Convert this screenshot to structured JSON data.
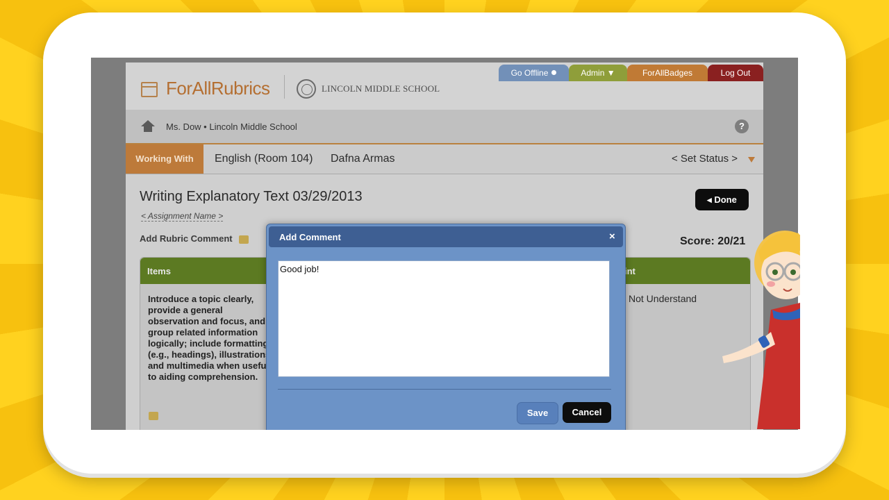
{
  "brand": {
    "app_name": "ForAllRubrics",
    "school_name": "LINCOLN MIDDLE SCHOOL"
  },
  "top_nav": [
    {
      "label": "Go Offline",
      "color": "#7290b8"
    },
    {
      "label": "Admin ▼",
      "color": "#8f9e3a"
    },
    {
      "label": "ForAllBadges",
      "color": "#c07a35"
    },
    {
      "label": "Log Out",
      "color": "#8a2020"
    }
  ],
  "breadcrumb": {
    "text": "Ms. Dow • Lincoln Middle School",
    "help": "?"
  },
  "context": {
    "working_with": "Working With",
    "class": "English (Room 104)",
    "student": "Dafna Armas",
    "set_status": "< Set Status >"
  },
  "assignment": {
    "title": "Writing Explanatory Text  03/29/2013",
    "name_placeholder": "< Assignment Name >",
    "done": "Done",
    "add_rubric_comment": "Add Rubric Comment",
    "score": "Score: 20/21"
  },
  "rubric": {
    "col_items": "Items",
    "col_point": "int",
    "item_text": "Introduce a topic clearly, provide a general observation and focus, and group related information logically; include formatting (e.g., headings), illustrations, and multimedia when useful to aiding comprehension.",
    "level_label": "Not Understand"
  },
  "modal": {
    "title": "Add Comment",
    "close": "×",
    "comment_value": "Good job!",
    "save": "Save",
    "cancel": "Cancel"
  },
  "colors": {
    "accent_orange": "#bd7a3a",
    "header_green": "#5c7a22",
    "modal_blue": "#6c93c7",
    "background_yellow": "#ffd21f"
  }
}
